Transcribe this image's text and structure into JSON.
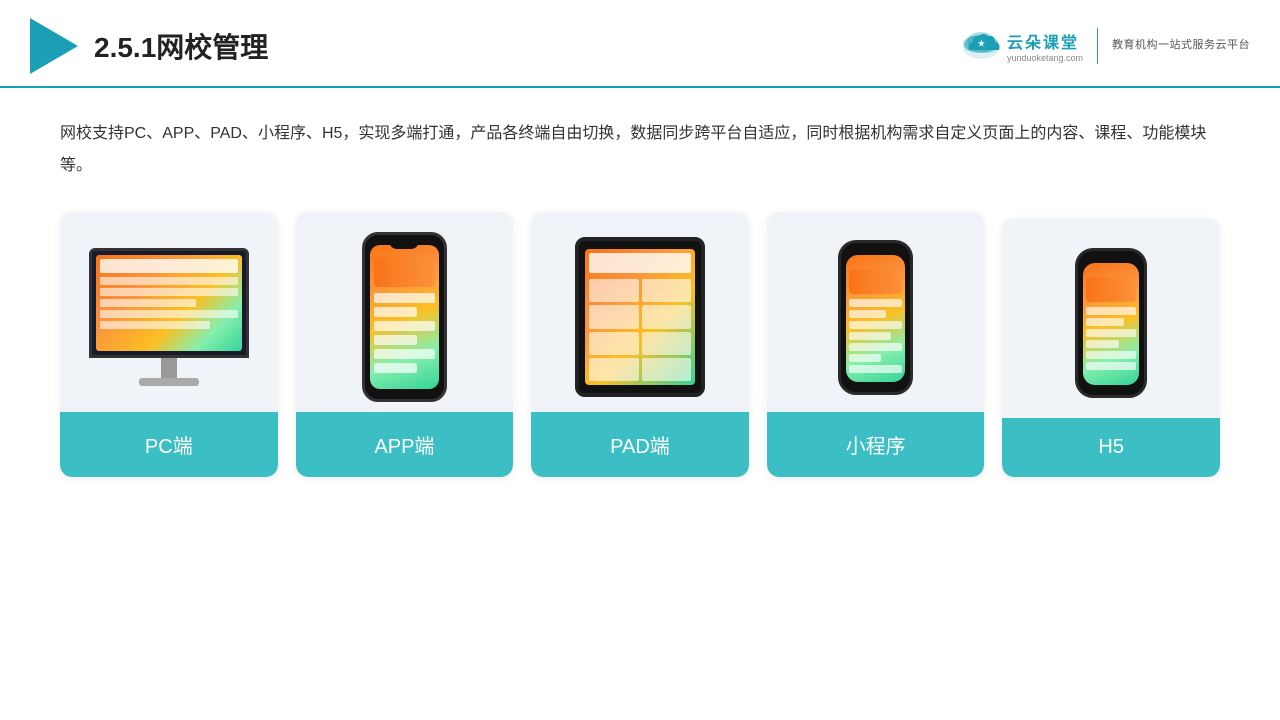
{
  "header": {
    "title": "2.5.1网校管理",
    "brand": {
      "name": "云朵课堂",
      "url": "yunduoketang.com",
      "sub": "教育机构一站式服务云平台"
    }
  },
  "description": "网校支持PC、APP、PAD、小程序、H5，实现多端打通，产品各终端自由切换，数据同步跨平台自适应，同时根据机构需求自定义页面上的内容、课程、功能模块等。",
  "cards": [
    {
      "id": "pc",
      "label": "PC端"
    },
    {
      "id": "app",
      "label": "APP端"
    },
    {
      "id": "pad",
      "label": "PAD端"
    },
    {
      "id": "miniprogram",
      "label": "小程序"
    },
    {
      "id": "h5",
      "label": "H5"
    }
  ],
  "colors": {
    "accent": "#1a9fb5",
    "card_bg": "#edf1f7",
    "card_label_bg": "#3bbfc4"
  }
}
